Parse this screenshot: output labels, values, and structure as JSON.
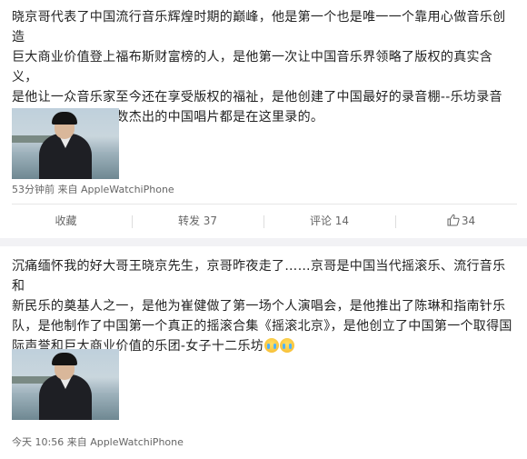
{
  "posts": [
    {
      "text": "晓京哥代表了中国流行音乐辉煌时期的巅峰，他是第一个也是唯一一个靠用心做音乐创造\n巨大商业价值登上福布斯财富榜的人，是他第一次让中国音乐界领略了版权的真实含义，\n是他让一众音乐家至今还在享受版权的福祉，是他创建了中国最好的录音棚--乐坊录音\n棚，这十年，大多数杰出的中国唱片都是在这里录的。",
      "image_icon": "photo-man-by-water",
      "meta": "53分钟前 来自 AppleWatchiPhone",
      "actions": {
        "favorite": "收藏",
        "forward": "转发 37",
        "comment": "评论 14",
        "like": "34"
      }
    },
    {
      "text": "沉痛缅怀我的好大哥王晓京先生，京哥昨夜走了……京哥是中国当代摇滚乐、流行音乐和\n新民乐的奠基人之一，是他为崔健做了第一场个人演唱会，是他推出了陈琳和指南针乐\n队，是他制作了中国第一个真正的摇滚合集《摇滚北京》，是他创立了中国第一个取得国\n际声誉和巨大商业价值的乐团-女子十二乐坊",
      "emoji_count": 2,
      "image_icon": "photo-man-by-water",
      "meta": "今天 10:56 来自 AppleWatchiPhone"
    }
  ],
  "colors": {
    "text": "#222222",
    "meta": "#666666",
    "separator": "#f2f2f5"
  }
}
